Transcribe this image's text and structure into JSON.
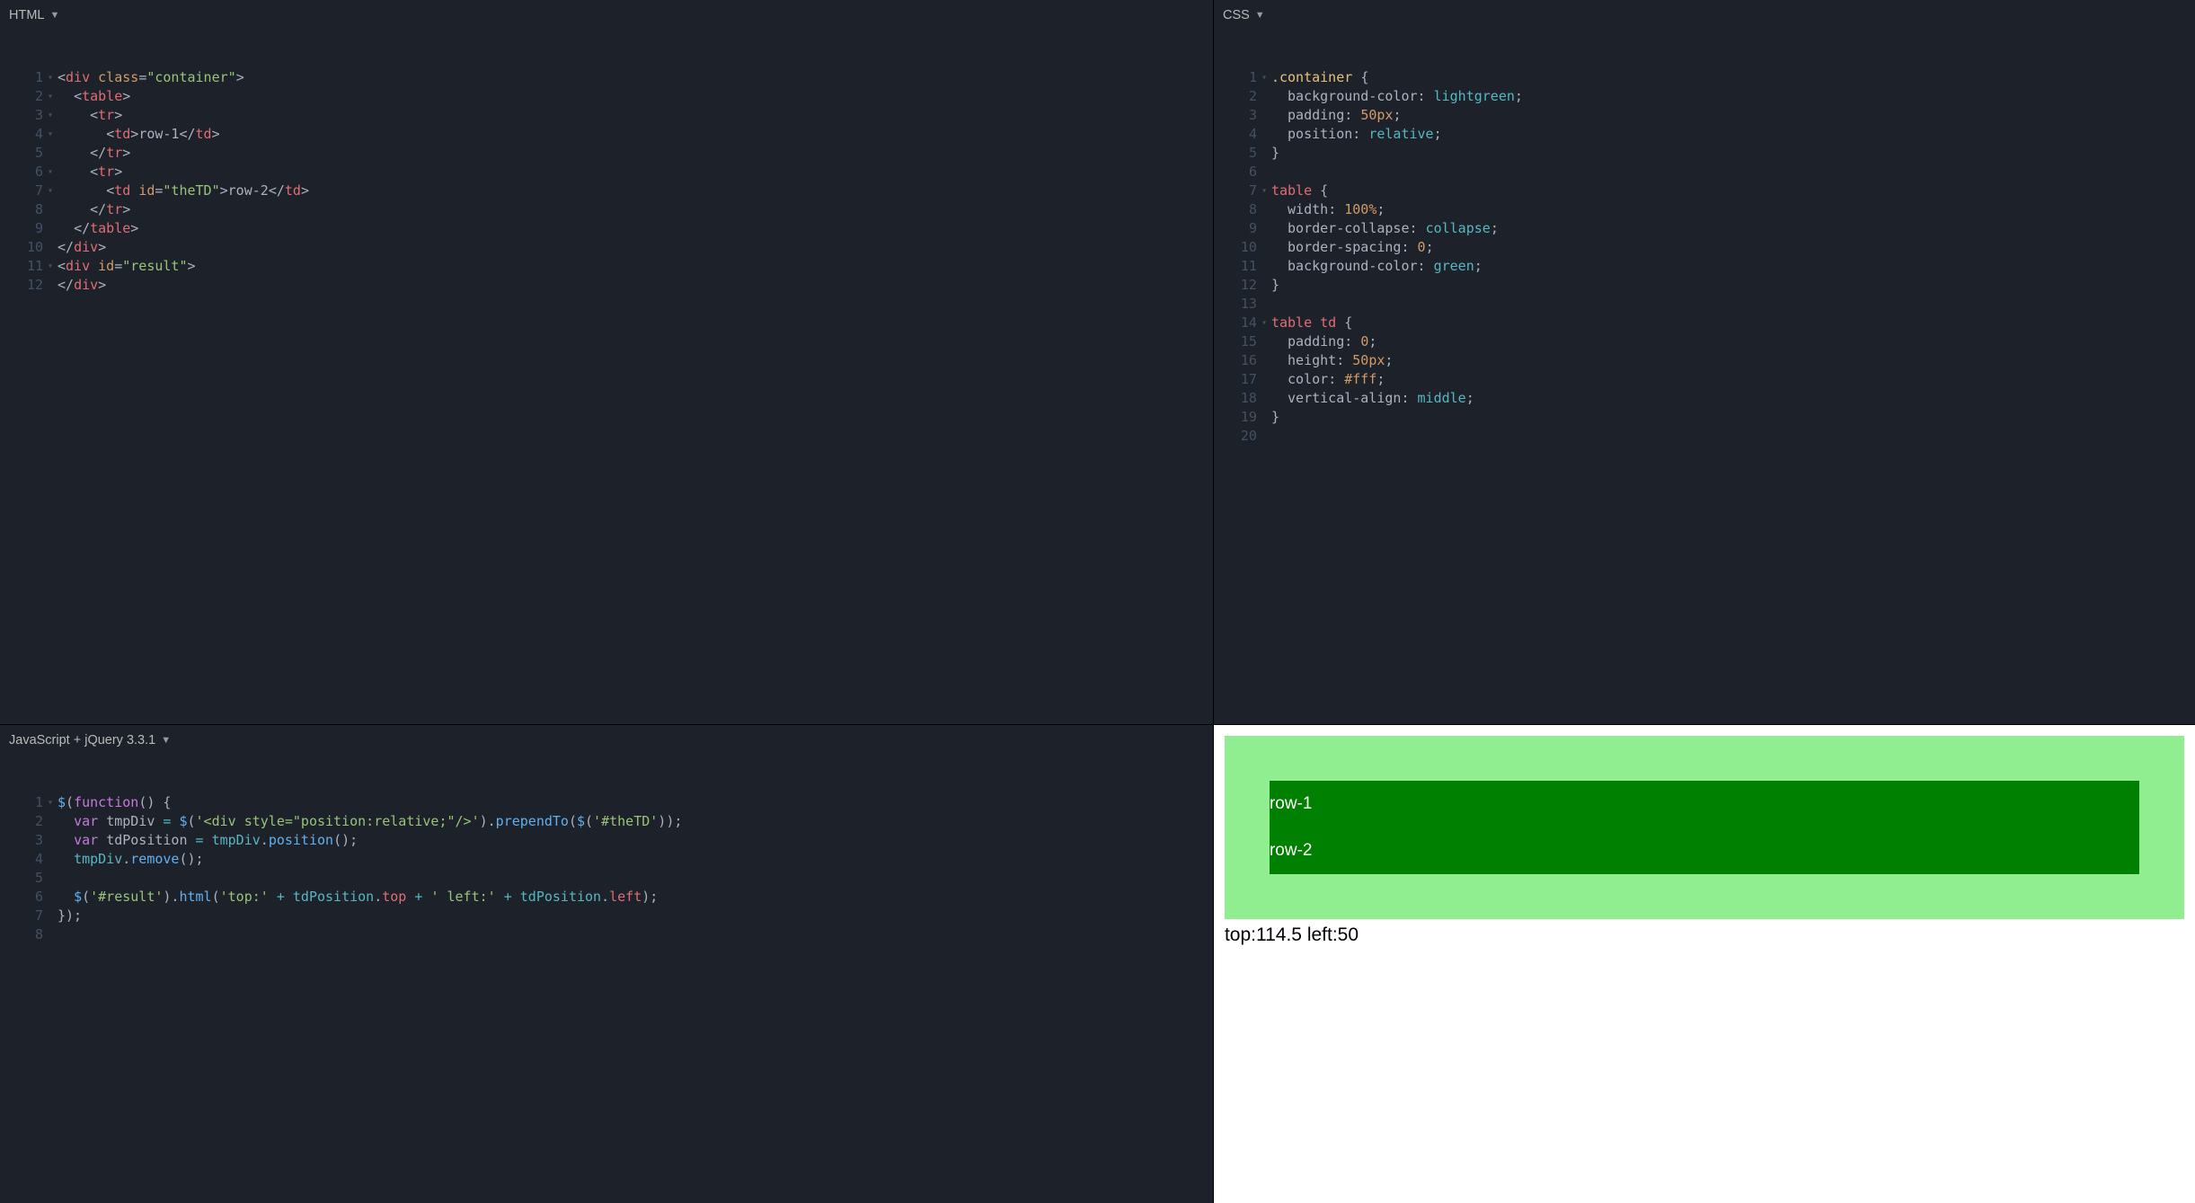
{
  "panes": {
    "html": {
      "title": "HTML"
    },
    "css": {
      "title": "CSS"
    },
    "js": {
      "title": "JavaScript + jQuery 3.3.1"
    }
  },
  "html_lines": [
    {
      "n": "1",
      "fold": "▾",
      "html": "<span class='punct'>&lt;</span><span class='tag'>div</span> <span class='attr'>class</span><span class='punct'>=</span><span class='str'>\"container\"</span><span class='punct'>&gt;</span>"
    },
    {
      "n": "2",
      "fold": "▾",
      "html": "  <span class='punct'>&lt;</span><span class='tag'>table</span><span class='punct'>&gt;</span>"
    },
    {
      "n": "3",
      "fold": "▾",
      "html": "    <span class='punct'>&lt;</span><span class='tag'>tr</span><span class='punct'>&gt;</span>"
    },
    {
      "n": "4",
      "fold": "▾",
      "html": "      <span class='punct'>&lt;</span><span class='tag'>td</span><span class='punct'>&gt;</span><span class='plain'>row-1</span><span class='punct'>&lt;/</span><span class='tag'>td</span><span class='punct'>&gt;</span>"
    },
    {
      "n": "5",
      "fold": "",
      "html": "    <span class='punct'>&lt;/</span><span class='tag'>tr</span><span class='punct'>&gt;</span>"
    },
    {
      "n": "6",
      "fold": "▾",
      "html": "    <span class='punct'>&lt;</span><span class='tag'>tr</span><span class='punct'>&gt;</span>"
    },
    {
      "n": "7",
      "fold": "▾",
      "html": "      <span class='punct'>&lt;</span><span class='tag'>td</span> <span class='attr'>id</span><span class='punct'>=</span><span class='str'>\"theTD\"</span><span class='punct'>&gt;</span><span class='plain'>row-2</span><span class='punct'>&lt;/</span><span class='tag'>td</span><span class='punct'>&gt;</span>"
    },
    {
      "n": "8",
      "fold": "",
      "html": "    <span class='punct'>&lt;/</span><span class='tag'>tr</span><span class='punct'>&gt;</span>"
    },
    {
      "n": "9",
      "fold": "",
      "html": "  <span class='punct'>&lt;/</span><span class='tag'>table</span><span class='punct'>&gt;</span>"
    },
    {
      "n": "10",
      "fold": "",
      "html": "<span class='punct'>&lt;/</span><span class='tag'>div</span><span class='punct'>&gt;</span>"
    },
    {
      "n": "11",
      "fold": "▾",
      "html": "<span class='punct'>&lt;</span><span class='tag'>div</span> <span class='attr'>id</span><span class='punct'>=</span><span class='str'>\"result\"</span><span class='punct'>&gt;</span>"
    },
    {
      "n": "12",
      "fold": "",
      "html": "<span class='punct'>&lt;/</span><span class='tag'>div</span><span class='punct'>&gt;</span>"
    }
  ],
  "css_lines": [
    {
      "n": "1",
      "fold": "▾",
      "html": "<span class='sel'>.container</span> <span class='punct'>{</span>"
    },
    {
      "n": "2",
      "fold": "",
      "html": "  <span class='plain'>background-color</span><span class='punct'>:</span> <span class='valk'>lightgreen</span><span class='punct'>;</span>"
    },
    {
      "n": "3",
      "fold": "",
      "html": "  <span class='plain'>padding</span><span class='punct'>:</span> <span class='val'>50px</span><span class='punct'>;</span>"
    },
    {
      "n": "4",
      "fold": "",
      "html": "  <span class='plain'>position</span><span class='punct'>:</span> <span class='valk'>relative</span><span class='punct'>;</span>"
    },
    {
      "n": "5",
      "fold": "",
      "html": "<span class='punct'>}</span>"
    },
    {
      "n": "6",
      "fold": "",
      "html": ""
    },
    {
      "n": "7",
      "fold": "▾",
      "html": "<span class='selTag'>table</span> <span class='punct'>{</span>"
    },
    {
      "n": "8",
      "fold": "",
      "html": "  <span class='plain'>width</span><span class='punct'>:</span> <span class='val'>100%</span><span class='punct'>;</span>"
    },
    {
      "n": "9",
      "fold": "",
      "html": "  <span class='plain'>border-collapse</span><span class='punct'>:</span> <span class='valk'>collapse</span><span class='punct'>;</span>"
    },
    {
      "n": "10",
      "fold": "",
      "html": "  <span class='plain'>border-spacing</span><span class='punct'>:</span> <span class='val'>0</span><span class='punct'>;</span>"
    },
    {
      "n": "11",
      "fold": "",
      "html": "  <span class='plain'>background-color</span><span class='punct'>:</span> <span class='valk'>green</span><span class='punct'>;</span>"
    },
    {
      "n": "12",
      "fold": "",
      "html": "<span class='punct'>}</span>"
    },
    {
      "n": "13",
      "fold": "",
      "html": ""
    },
    {
      "n": "14",
      "fold": "▾",
      "html": "<span class='selTag'>table td</span> <span class='punct'>{</span>"
    },
    {
      "n": "15",
      "fold": "",
      "html": "  <span class='plain'>padding</span><span class='punct'>:</span> <span class='val'>0</span><span class='punct'>;</span>"
    },
    {
      "n": "16",
      "fold": "",
      "html": "  <span class='plain'>height</span><span class='punct'>:</span> <span class='val'>50px</span><span class='punct'>;</span>"
    },
    {
      "n": "17",
      "fold": "",
      "html": "  <span class='plain'>color</span><span class='punct'>:</span> <span class='val'>#fff</span><span class='punct'>;</span>"
    },
    {
      "n": "18",
      "fold": "",
      "html": "  <span class='plain'>vertical-align</span><span class='punct'>:</span> <span class='valk'>middle</span><span class='punct'>;</span>"
    },
    {
      "n": "19",
      "fold": "",
      "html": "<span class='punct'>}</span>"
    },
    {
      "n": "20",
      "fold": "",
      "html": ""
    }
  ],
  "js_lines": [
    {
      "n": "1",
      "fold": "▾",
      "html": "<span class='fn'>$</span><span class='punct'>(</span><span class='kw'>function</span><span class='punct'>() {</span>"
    },
    {
      "n": "2",
      "fold": "",
      "html": "  <span class='kw'>var</span> <span class='plain'>tmpDiv</span> <span class='op'>=</span> <span class='fn'>$</span><span class='punct'>(</span><span class='str'>'&lt;div style=\"position:relative;\"/&gt;'</span><span class='punct'>).</span><span class='fn'>prependTo</span><span class='punct'>(</span><span class='fn'>$</span><span class='punct'>(</span><span class='str'>'#theTD'</span><span class='punct'>));</span>"
    },
    {
      "n": "3",
      "fold": "",
      "html": "  <span class='kw'>var</span> <span class='plain'>tdPosition</span> <span class='op'>=</span> <span class='varb'>tmpDiv</span><span class='punct'>.</span><span class='fn'>position</span><span class='punct'>();</span>"
    },
    {
      "n": "4",
      "fold": "",
      "html": "  <span class='varb'>tmpDiv</span><span class='punct'>.</span><span class='fn'>remove</span><span class='punct'>();</span>"
    },
    {
      "n": "5",
      "fold": "",
      "html": ""
    },
    {
      "n": "6",
      "fold": "",
      "html": "  <span class='fn'>$</span><span class='punct'>(</span><span class='str'>'#result'</span><span class='punct'>).</span><span class='fn'>html</span><span class='punct'>(</span><span class='str'>'top:'</span> <span class='op'>+</span> <span class='varb'>tdPosition</span><span class='punct'>.</span><span class='var'>top</span> <span class='op'>+</span> <span class='str'>' left:'</span> <span class='op'>+</span> <span class='varb'>tdPosition</span><span class='punct'>.</span><span class='var'>left</span><span class='punct'>);</span>"
    },
    {
      "n": "7",
      "fold": "",
      "html": "<span class='punct'>});</span>"
    },
    {
      "n": "8",
      "fold": "",
      "html": ""
    }
  ],
  "output": {
    "rows": [
      "row-1",
      "row-2"
    ],
    "result": "top:114.5 left:50"
  }
}
